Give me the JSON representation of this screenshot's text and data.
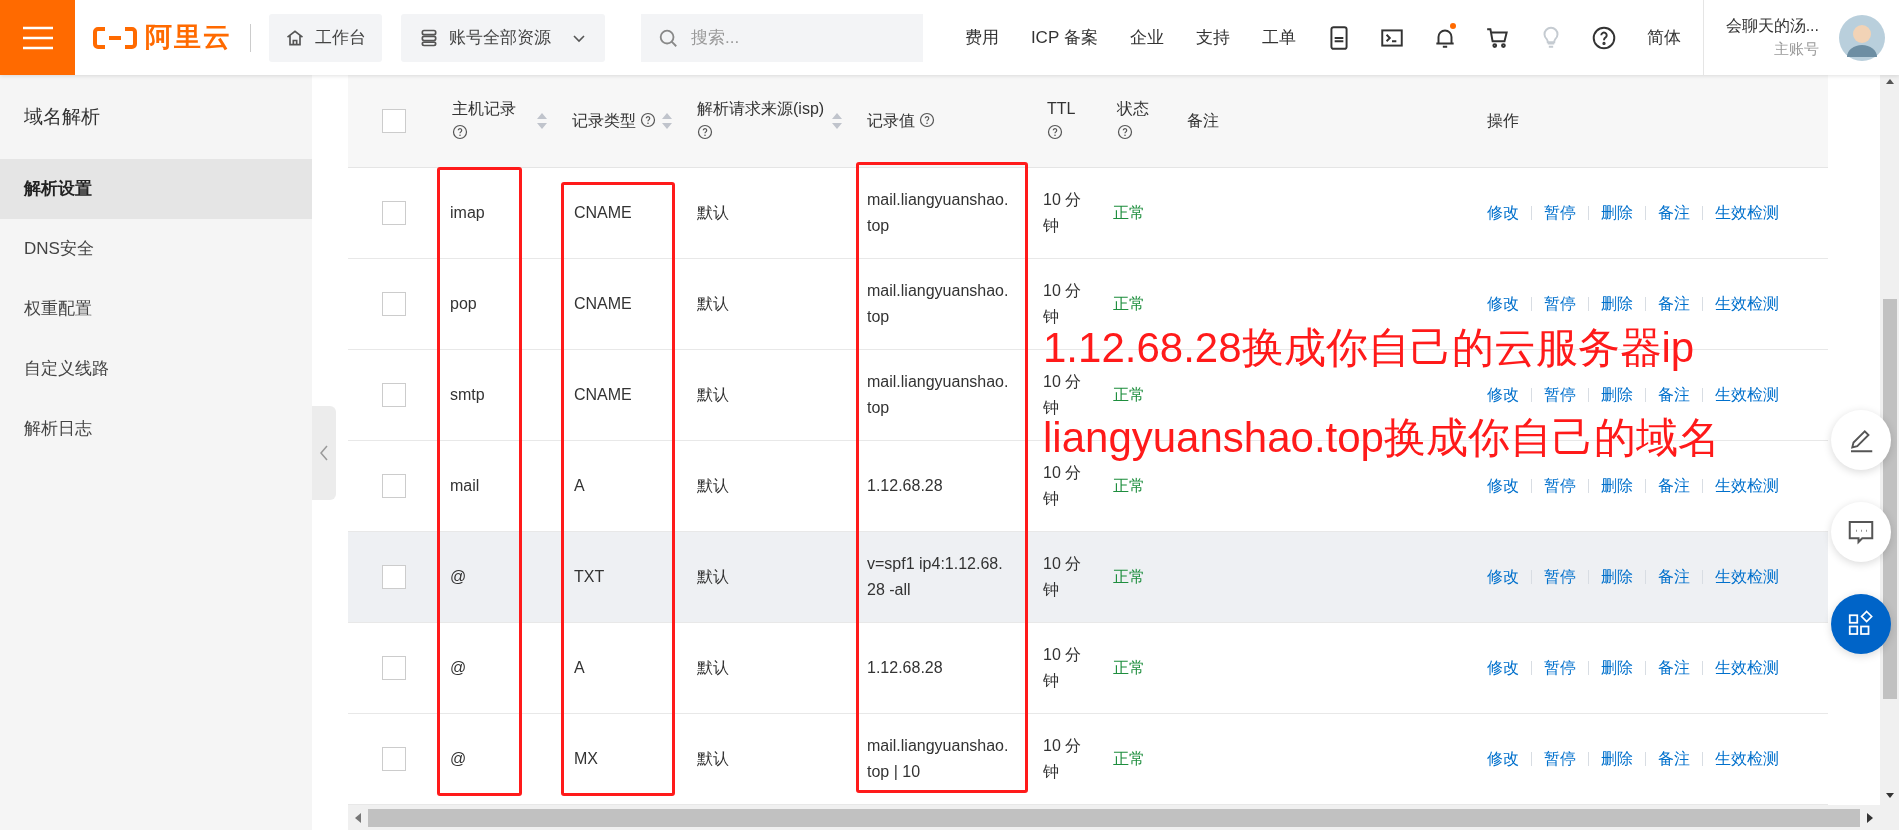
{
  "topbar": {
    "logo": "阿里云",
    "workbench": "工作台",
    "resources": "账号全部资源",
    "search": {
      "placeholder": "搜索..."
    },
    "nav": [
      "费用",
      "ICP 备案",
      "企业",
      "支持",
      "工单"
    ],
    "icons": [
      {
        "kind": "app"
      },
      {
        "kind": "terminal"
      },
      {
        "kind": "bell",
        "dot": true
      },
      {
        "kind": "cart"
      },
      {
        "kind": "bulb"
      },
      {
        "kind": "help"
      }
    ],
    "language": "简体",
    "user": {
      "name": "会聊天的汤...",
      "role": "主账号"
    }
  },
  "sidebar": {
    "title": "域名解析",
    "items": [
      {
        "label": "解析设置",
        "selected": true
      },
      {
        "label": "DNS安全",
        "selected": false
      },
      {
        "label": "权重配置",
        "selected": false
      },
      {
        "label": "自定义线路",
        "selected": false
      },
      {
        "label": "解析日志",
        "selected": false
      }
    ]
  },
  "table": {
    "select_all_checked": false,
    "columns": [
      {
        "label": "主机记录",
        "help": true,
        "sortable": true
      },
      {
        "label": "记录类型",
        "help": true,
        "sortable": true
      },
      {
        "label": "解析请求来源(isp)",
        "help": true,
        "sortable": true
      },
      {
        "label": "记录值",
        "help": true,
        "sortable": false
      },
      {
        "label": "TTL",
        "help": true,
        "sortable": false
      },
      {
        "label": "状态",
        "help": true,
        "sortable": false
      },
      {
        "label": "备注",
        "help": false,
        "sortable": false
      },
      {
        "label": "操作",
        "help": false,
        "sortable": false
      }
    ],
    "rows": [
      {
        "checked": false,
        "highlighted": false,
        "host": "imap",
        "type": "CNAME",
        "source": "默认",
        "value": "mail.liangyuanshao.top",
        "ttl": "10 分钟",
        "status": "正常",
        "actions": [
          "修改",
          "暂停",
          "删除",
          "备注",
          "生效检测"
        ]
      },
      {
        "checked": false,
        "highlighted": false,
        "host": "pop",
        "type": "CNAME",
        "source": "默认",
        "value": "mail.liangyuanshao.top",
        "ttl": "10 分钟",
        "status": "正常",
        "actions": [
          "修改",
          "暂停",
          "删除",
          "备注",
          "生效检测"
        ]
      },
      {
        "checked": false,
        "highlighted": false,
        "host": "smtp",
        "type": "CNAME",
        "source": "默认",
        "value": "mail.liangyuanshao.top",
        "ttl": "10 分钟",
        "status": "正常",
        "actions": [
          "修改",
          "暂停",
          "删除",
          "备注",
          "生效检测"
        ]
      },
      {
        "checked": false,
        "highlighted": false,
        "host": "mail",
        "type": "A",
        "source": "默认",
        "value": "1.12.68.28",
        "ttl": "10 分钟",
        "status": "正常",
        "actions": [
          "修改",
          "暂停",
          "删除",
          "备注",
          "生效检测"
        ]
      },
      {
        "checked": false,
        "highlighted": true,
        "host": "@",
        "type": "TXT",
        "source": "默认",
        "value": "v=spf1 ip4:1.12.68.28 -all",
        "ttl": "10 分钟",
        "status": "正常",
        "actions": [
          "修改",
          "暂停",
          "删除",
          "备注",
          "生效检测"
        ]
      },
      {
        "checked": false,
        "highlighted": false,
        "host": "@",
        "type": "A",
        "source": "默认",
        "value": "1.12.68.28",
        "ttl": "10 分钟",
        "status": "正常",
        "actions": [
          "修改",
          "暂停",
          "删除",
          "备注",
          "生效检测"
        ]
      },
      {
        "checked": false,
        "highlighted": false,
        "host": "@",
        "type": "MX",
        "source": "默认",
        "value": "mail.liangyuanshao.top | 10",
        "ttl": "10 分钟",
        "status": "正常",
        "actions": [
          "修改",
          "暂停",
          "删除",
          "备注",
          "生效检测"
        ]
      }
    ]
  },
  "annotations": [
    "1.12.68.28换成你自己的云服务器ip",
    "liangyuanshao.top换成你自己的域名"
  ],
  "floating": [
    {
      "kind": "edit"
    },
    {
      "kind": "chat"
    },
    {
      "kind": "apps"
    }
  ]
}
